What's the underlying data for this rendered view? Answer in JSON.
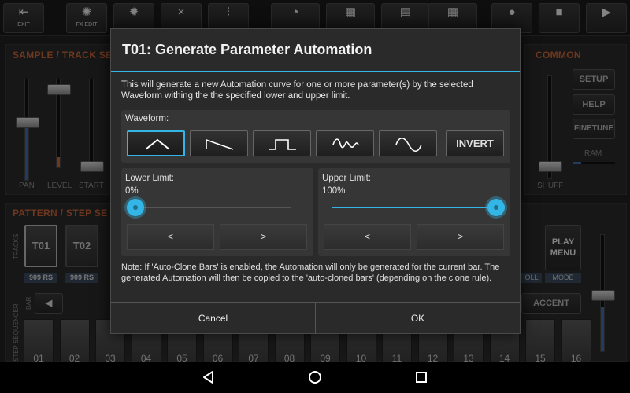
{
  "toolbar": {
    "exit_label": "EXIT",
    "fx_edit_label": "FX EDIT",
    "items": [
      "exit-icon",
      "fx-edit-icon",
      "effect-icon",
      "close-icon",
      "mixer-icon",
      "tempo-icon",
      "keyboard-icon",
      "archive-icon",
      "grid-icon",
      "record-icon",
      "stop-icon",
      "play-icon"
    ]
  },
  "background": {
    "sample_track_title": "SAMPLE / TRACK SE",
    "common_title": "COMMON",
    "pattern_step_title": "PATTERN / STEP SE",
    "fader_labels": [
      "PAN",
      "LEVEL",
      "START"
    ],
    "shuffle_label": "SHUFF",
    "ram_label": "RAM",
    "side_buttons": [
      "SETUP",
      "HELP",
      "FINETUNE"
    ],
    "tracks_label": "TRACKS",
    "tracks": [
      "T01",
      "T02"
    ],
    "track_subs": [
      "909 RS",
      "909 RS"
    ],
    "play_menu_label": "PLAY\nMENU",
    "roll_label": "OLL",
    "mode_label": "MODE",
    "accent_label": "ACCENT",
    "bar_label": "BAR",
    "step_sequencer_label": "STEP SEQUENCER",
    "steps": [
      "01",
      "02",
      "03",
      "04",
      "05",
      "06",
      "07",
      "08",
      "09",
      "10",
      "11",
      "12",
      "13",
      "14",
      "15",
      "16"
    ]
  },
  "dialog": {
    "title": "T01: Generate Parameter Automation",
    "description": "This will generate a new Automation curve for one or more parameter(s) by the selected Waveform withing the the specified lower and upper limit.",
    "waveform_label": "Waveform:",
    "waveforms": [
      "triangle-wave-icon",
      "ramp-down-wave-icon",
      "square-wave-icon",
      "random-wave-icon",
      "sine-wave-icon"
    ],
    "selected_waveform": "triangle-wave-icon",
    "invert_label": "INVERT",
    "lower_limit_label": "Lower Limit:",
    "lower_limit_value": "0%",
    "lower_limit_fraction": 0.0,
    "upper_limit_label": "Upper Limit:",
    "upper_limit_value": "100%",
    "upper_limit_fraction": 1.0,
    "decrement_label": "<",
    "increment_label": ">",
    "note": "Note: If 'Auto-Clone Bars' is enabled, the Automation will only be generated for the current bar. The generated Automation will then be copied to the 'auto-cloned bars' (depending on the clone rule).",
    "cancel_label": "Cancel",
    "ok_label": "OK"
  },
  "colors": {
    "accent": "#33b5e5",
    "section_title": "#c8643a"
  },
  "navbar": {
    "items": [
      "back-icon",
      "home-icon",
      "recents-icon"
    ]
  }
}
